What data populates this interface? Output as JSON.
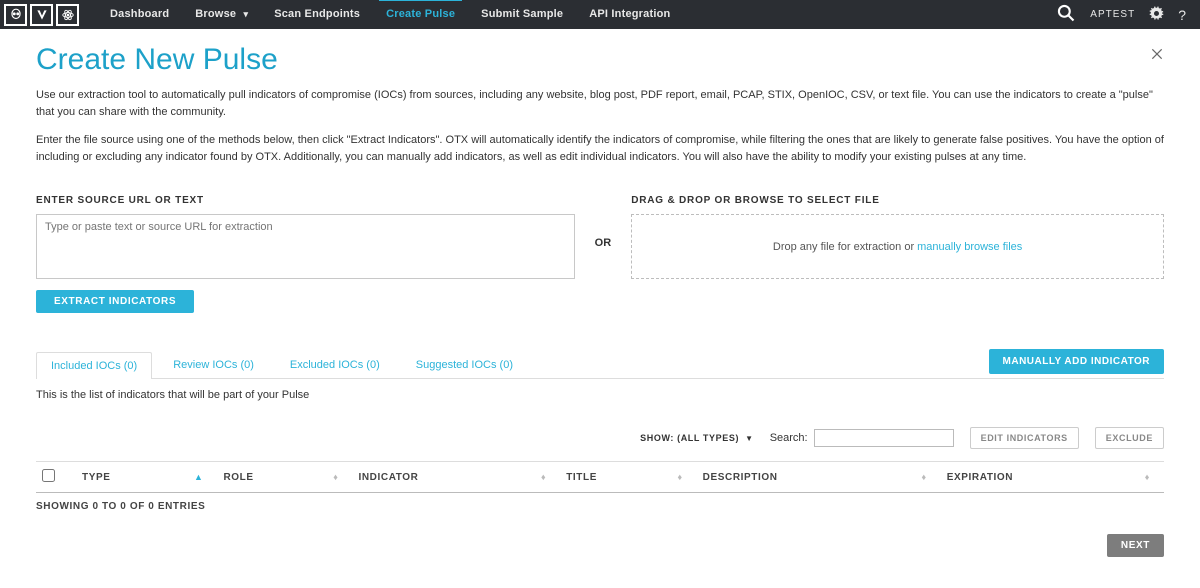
{
  "nav": {
    "items": [
      {
        "label": "Dashboard"
      },
      {
        "label": "Browse",
        "dropdown": true
      },
      {
        "label": "Scan Endpoints"
      },
      {
        "label": "Create Pulse",
        "active": true
      },
      {
        "label": "Submit Sample"
      },
      {
        "label": "API Integration"
      }
    ],
    "user_label": "APTEST"
  },
  "page": {
    "title": "Create New Pulse",
    "p1": "Use our extraction tool to automatically pull indicators of compromise (IOCs) from sources, including any website, blog post, PDF report, email, PCAP, STIX, OpenIOC, CSV, or text file. You can use the indicators to create a \"pulse\" that you can share with the community.",
    "p2": "Enter the file source using one of the methods below, then click \"Extract Indicators\". OTX will automatically identify the indicators of compromise, while filtering the ones that are likely to generate false positives. You have the option of including or excluding any indicator found by OTX. Additionally, you can manually add indicators, as well as edit individual indicators. You will also have the ability to modify your existing pulses at any time."
  },
  "source": {
    "label": "ENTER SOURCE URL OR TEXT",
    "placeholder": "Type or paste text or source URL for extraction",
    "extract_label": "EXTRACT INDICATORS",
    "or_label": "OR"
  },
  "drop": {
    "label": "DRAG & DROP OR BROWSE TO SELECT FILE",
    "text": "Drop any file for extraction or ",
    "link": "manually browse files"
  },
  "tabs": {
    "t0": "Included IOCs (0)",
    "t1": "Review IOCs (0)",
    "t2": "Excluded IOCs (0)",
    "t3": "Suggested IOCs (0)",
    "manual_label": "MANUALLY ADD INDICATOR",
    "list_desc": "This is the list of indicators that will be part of your Pulse"
  },
  "controls": {
    "show_label": "SHOW: (ALL TYPES)",
    "search_label": "Search:",
    "edit_label": "EDIT INDICATORS",
    "exclude_label": "EXCLUDE"
  },
  "table": {
    "h_type": "TYPE",
    "h_role": "ROLE",
    "h_indicator": "INDICATOR",
    "h_title": "TITLE",
    "h_description": "DESCRIPTION",
    "h_expiration": "EXPIRATION",
    "showing": "SHOWING 0 TO 0 OF 0 ENTRIES",
    "next_label": "NEXT"
  }
}
